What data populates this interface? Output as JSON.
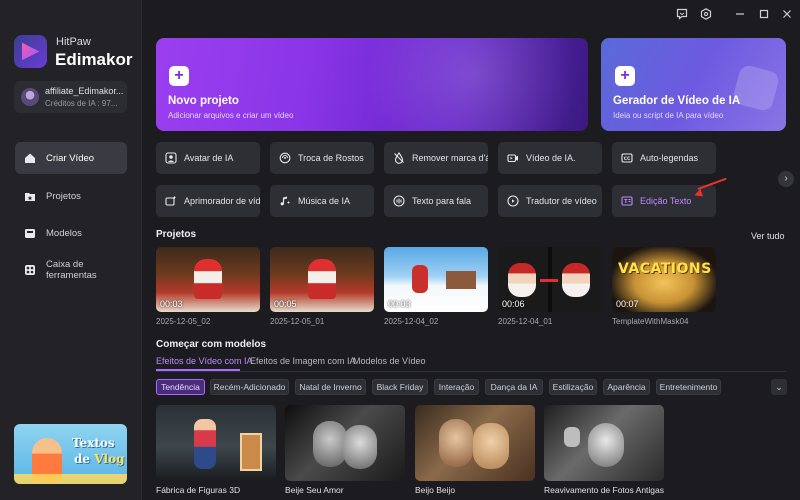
{
  "app": {
    "brand_top": "HitPaw",
    "brand_main": "Edimakor",
    "account_name": "affiliate_Edimakor...",
    "account_credits": "Créditos de IA : 97..."
  },
  "sidebar": {
    "items": [
      {
        "label": "Criar Vídeo",
        "icon": "home-icon",
        "active": true
      },
      {
        "label": "Projetos",
        "icon": "folder-star-icon",
        "active": false
      },
      {
        "label": "Modelos",
        "icon": "template-box-icon",
        "active": false
      },
      {
        "label": "Caixa de ferramentas",
        "icon": "toolbox-icon",
        "active": false
      }
    ],
    "promo": {
      "line1": "Textos",
      "line2_pre": "de ",
      "line2_em": "Vlog"
    }
  },
  "hero": {
    "new_project": {
      "title": "Novo projeto",
      "subtitle": "Adicionar arquivos e criar um vídeo"
    },
    "ai_video": {
      "title": "Gerador de Vídeo de IA",
      "subtitle": "Ideia ou script de IA para vídeo"
    }
  },
  "tools": {
    "row1": [
      {
        "label": "Avatar de IA",
        "icon": "avatar-icon"
      },
      {
        "label": "Troca de Rostos",
        "icon": "face-swap-icon"
      },
      {
        "label": "Remover marca d'água",
        "icon": "watermark-remove-icon"
      },
      {
        "label": "Vídeo de IA.",
        "icon": "ai-video-icon"
      },
      {
        "label": "Auto-legendas",
        "icon": "captions-icon"
      }
    ],
    "row2": [
      {
        "label": "Aprimorador de vídeo",
        "icon": "enhance-icon"
      },
      {
        "label": "Música de IA",
        "icon": "music-icon"
      },
      {
        "label": "Texto para fala",
        "icon": "tts-icon"
      },
      {
        "label": "Tradutor de vídeo",
        "icon": "translate-icon"
      },
      {
        "label": "Edição Texto",
        "icon": "text-edit-icon",
        "highlight": true
      }
    ]
  },
  "projects": {
    "title": "Projetos",
    "see_all": "Ver tudo",
    "items": [
      {
        "name": "2025-12-05_02",
        "duration": "00:03"
      },
      {
        "name": "2025-12-05_01",
        "duration": "00:05"
      },
      {
        "name": "2025-12-04_02",
        "duration": "00:03"
      },
      {
        "name": "2025-12-04_01",
        "duration": "00:06"
      },
      {
        "name": "TemplateWithMask04",
        "duration": "00:07",
        "thumb_text": "VACATIONS"
      }
    ]
  },
  "models": {
    "title": "Começar com modelos",
    "tabs": [
      "Efeitos de Vídeo com IA",
      "Efeitos de Imagem com IA",
      "Modelos de Vídeo"
    ],
    "chips": [
      "Tendência",
      "Recém-Adicionado",
      "Natal de Inverno",
      "Black Friday",
      "Interação",
      "Dança da IA",
      "Estilização",
      "Aparência",
      "Entretenimento"
    ],
    "cards": [
      "Fábrica de Figuras 3D",
      "Beije Seu Amor",
      "Beijo Beijo",
      "Reavivamento de Fotos Antigas"
    ]
  },
  "colors": {
    "accent": "#a66cff",
    "annotation_arrow": "#e3342f"
  }
}
